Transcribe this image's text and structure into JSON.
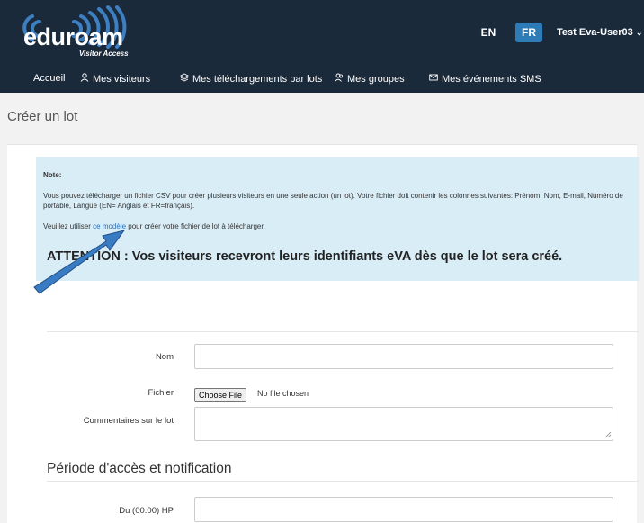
{
  "header": {
    "logo": {
      "name": "eduroam",
      "subtitle": "Visitor Access"
    },
    "languages": [
      {
        "code": "EN",
        "active": false
      },
      {
        "code": "FR",
        "active": true
      }
    ],
    "user": {
      "name": "Test Eva-User03",
      "icon": "chevron-down-icon"
    },
    "colors": {
      "bar": "#1a2a3b",
      "accent": "#2d7cb8"
    }
  },
  "nav": {
    "items": [
      {
        "label": "Accueil",
        "icon": ""
      },
      {
        "label": "Mes visiteurs",
        "icon": "user-icon"
      },
      {
        "label": "Mes téléchargements par lots",
        "icon": "layers-icon"
      },
      {
        "label": "Mes groupes",
        "icon": "users-icon"
      },
      {
        "label": "Mes événements SMS",
        "icon": "envelope-icon"
      }
    ]
  },
  "page": {
    "title": "Créer un lot"
  },
  "note": {
    "label": "Note:",
    "text1": "Vous pouvez télécharger un fichier CSV pour créer plusieurs visiteurs en une seule action (un lot). Votre fichier doit contenir les colonnes suivantes: Prénom, Nom, E-mail, Numéro de portable, Langue (EN= Anglais et FR=français).",
    "text2_before": "Veuillez utiliser ",
    "text2_link": "ce modèle",
    "text2_after": " pour créer votre fichier de lot à télécharger.",
    "warning": "ATTENTION : Vos visiteurs recevront leurs identifiants eVA dès que le lot sera créé."
  },
  "form": {
    "name_label": "Nom",
    "name_value": "",
    "file_label": "Fichier",
    "file_button": "Choose File",
    "file_status": "No file chosen",
    "comments_label": "Commentaires sur le lot",
    "comments_value": "",
    "section_title": "Période d'accès et notification",
    "from_label": "Du (00:00) HP",
    "from_value": ""
  }
}
